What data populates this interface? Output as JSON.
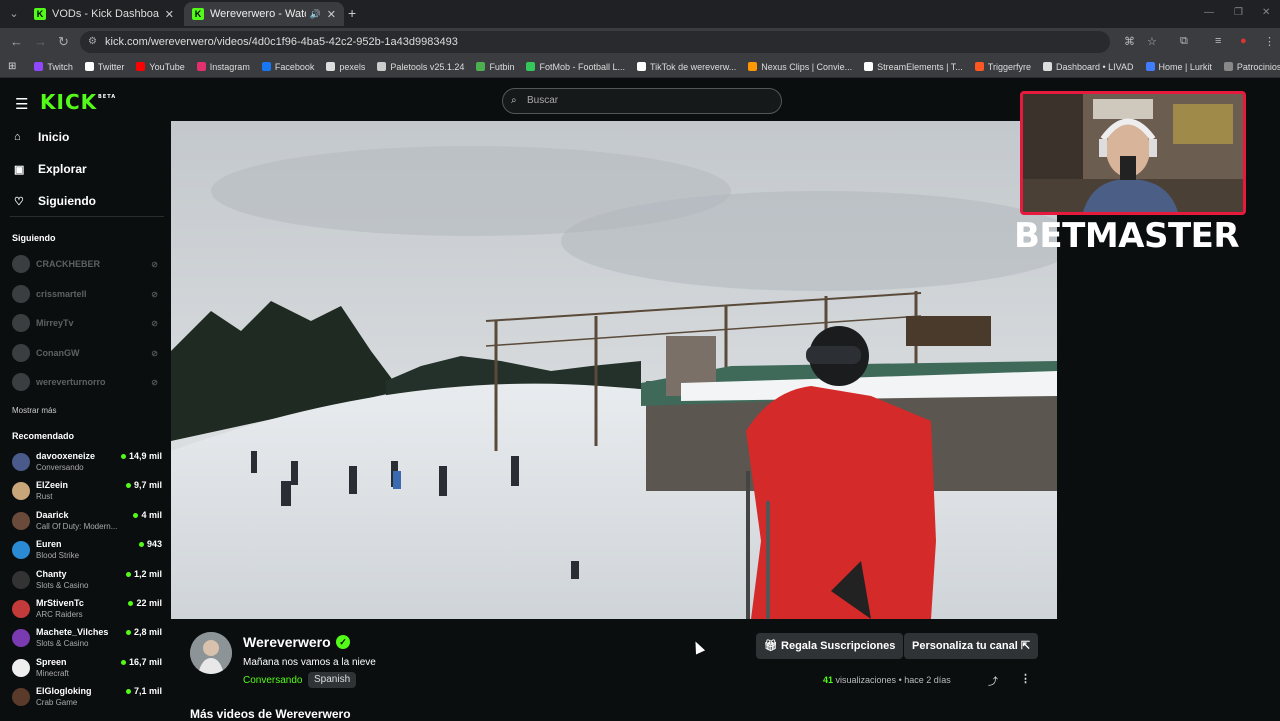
{
  "browser": {
    "tabs": [
      {
        "title": "VODs - Kick Dashboard",
        "active": false
      },
      {
        "title": "Wereverwero - Watch the V",
        "active": true
      }
    ],
    "url": "kick.com/wereverwero/videos/4d0c1f96-4ba5-42c2-952b-1a43d9983493",
    "bookmarks": [
      {
        "label": "Twitch",
        "color": "#9146ff"
      },
      {
        "label": "Twitter",
        "color": "#ffffff"
      },
      {
        "label": "YouTube",
        "color": "#ff0000"
      },
      {
        "label": "Instagram",
        "color": "#e1306c"
      },
      {
        "label": "Facebook",
        "color": "#1877f2"
      },
      {
        "label": "pexels",
        "color": "#dddddd"
      },
      {
        "label": "Paletools v25.1.24",
        "color": "#cccccc"
      },
      {
        "label": "Futbin",
        "color": "#4caf50"
      },
      {
        "label": "FotMob - Football L...",
        "color": "#34c759"
      },
      {
        "label": "TikTok de wereverw...",
        "color": "#ffffff"
      },
      {
        "label": "Nexus Clips | Convie...",
        "color": "#ff9800"
      },
      {
        "label": "StreamElements | T...",
        "color": "#ffffff"
      },
      {
        "label": "Triggerfyre",
        "color": "#ff5722"
      },
      {
        "label": "Dashboard • LIVAD",
        "color": "#dddddd"
      },
      {
        "label": "Home | Lurkit",
        "color": "#3f7cff"
      },
      {
        "label": "Patrocinios disponib...",
        "color": "#888888"
      }
    ]
  },
  "header": {
    "logo": "KICK",
    "logo_badge": "BETA",
    "search_placeholder": "Buscar"
  },
  "sidebar": {
    "nav": [
      {
        "label": "Inicio",
        "icon": "home-icon"
      },
      {
        "label": "Explorar",
        "icon": "browse-icon"
      },
      {
        "label": "Siguiendo",
        "icon": "heart-icon"
      }
    ],
    "following_title": "Siguiendo",
    "following": [
      {
        "name": "CRACKHEBER"
      },
      {
        "name": "crissmartell"
      },
      {
        "name": "MirreyTv"
      },
      {
        "name": "ConanGW"
      },
      {
        "name": "wereverturnorro"
      }
    ],
    "show_more": "Mostrar más",
    "recommended_title": "Recomendado",
    "recommended": [
      {
        "name": "davooxeneize",
        "category": "Conversando",
        "viewers": "14,9 mil",
        "color": "#4a5a8a"
      },
      {
        "name": "ElZeein",
        "category": "Rust",
        "viewers": "9,7 mil",
        "color": "#c9a57a"
      },
      {
        "name": "Daarick",
        "category": "Call Of Duty: Modern...",
        "viewers": "4 mil",
        "color": "#6a4a3a"
      },
      {
        "name": "Euren",
        "category": "Blood Strike",
        "viewers": "943",
        "color": "#2a8ad4"
      },
      {
        "name": "Chanty",
        "category": "Slots & Casino",
        "viewers": "1,2 mil",
        "color": "#333333"
      },
      {
        "name": "MrStivenTc",
        "category": "ARC Raiders",
        "viewers": "22 mil",
        "color": "#c23a3a"
      },
      {
        "name": "Machete_Vilches",
        "category": "Slots & Casino",
        "viewers": "2,8 mil",
        "color": "#7a3ab0"
      },
      {
        "name": "Spreen",
        "category": "Minecraft",
        "viewers": "16,7 mil",
        "color": "#eeeeee"
      },
      {
        "name": "ElGlogloking",
        "category": "Crab Game",
        "viewers": "7,1 mil",
        "color": "#5a3a2a"
      }
    ]
  },
  "overlay": {
    "sponsor": "BETMASTER"
  },
  "channel": {
    "name": "Wereverwero",
    "title": "Mañana nos vamos a la nieve",
    "category": "Conversando",
    "language": "Spanish",
    "views_count": "41",
    "views_label": "visualizaciones",
    "separator": "•",
    "time_ago": "hace 2 días",
    "gift_button": "Regala Suscripciones",
    "customize_button": "Personaliza tu canal",
    "more_videos": "Más videos de Wereverwero"
  }
}
